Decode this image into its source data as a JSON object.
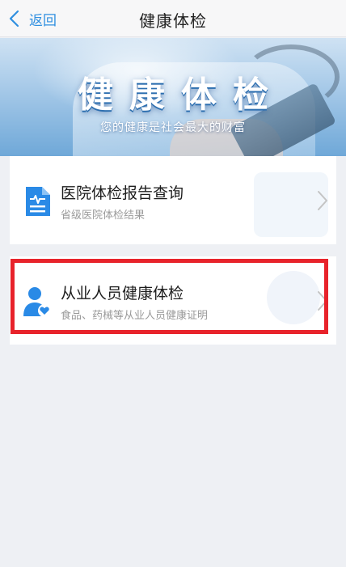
{
  "nav": {
    "back_label": "返回",
    "title": "健康体检"
  },
  "banner": {
    "title": "健康体检",
    "subtitle": "您的健康是社会最大的财富"
  },
  "services": [
    {
      "title": "医院体检报告查询",
      "subtitle": "省级医院体检结果",
      "icon": "report-document-icon"
    },
    {
      "title": "从业人员健康体检",
      "subtitle": "食品、药械等从业人员健康证明",
      "icon": "user-heart-icon",
      "highlighted": true
    }
  ],
  "colors": {
    "accent": "#2f8fe0",
    "highlight_border": "#e8232b",
    "icon_blue": "#2a8ae6"
  }
}
